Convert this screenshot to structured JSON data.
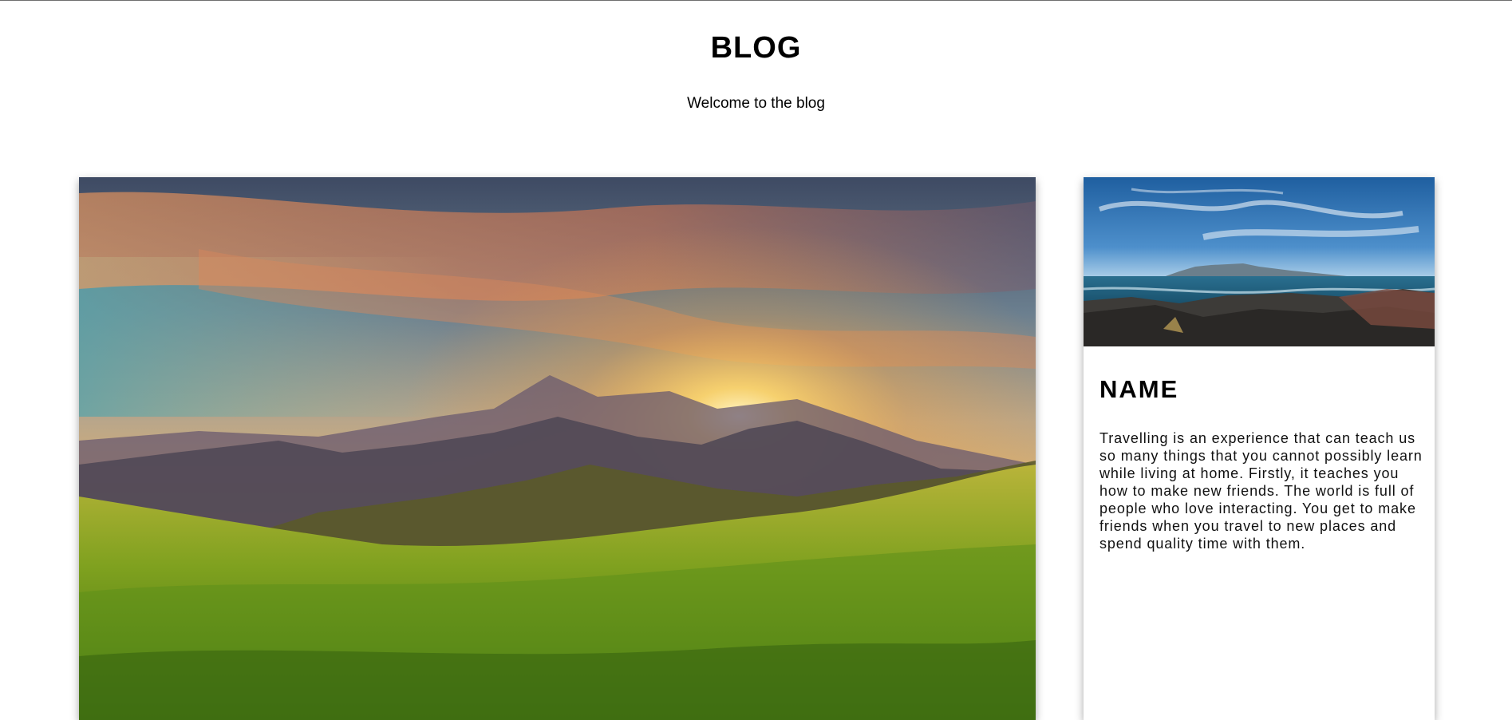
{
  "header": {
    "title": "BLOG",
    "subtitle": "Welcome to the blog"
  },
  "hero": {
    "image": "mountain-sunset-photo"
  },
  "card": {
    "image": "rocky-coast-ocean-photo",
    "name": "NAME",
    "text": "Travelling is an experience that can teach us so many things that you cannot possibly learn while living at home. Firstly, it teaches you how to make new friends. The world is full of people who love interacting. You get to make friends when you travel to new places and spend quality time with them."
  }
}
